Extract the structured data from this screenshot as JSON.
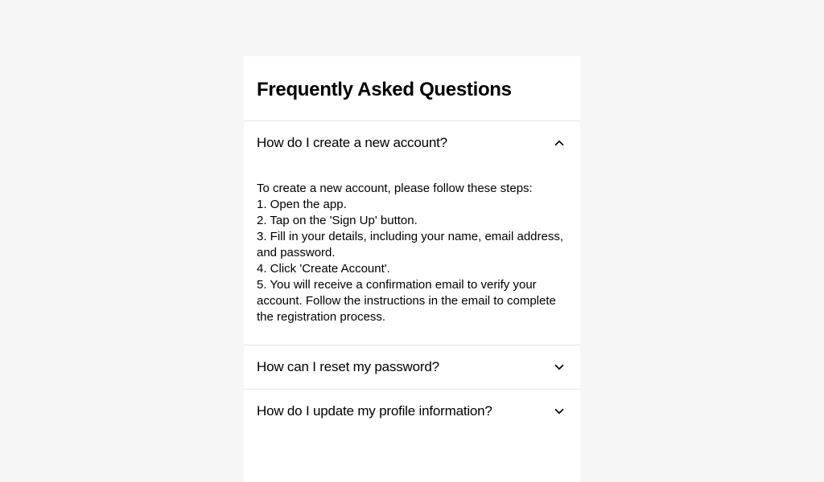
{
  "faq": {
    "title": "Frequently Asked Questions",
    "items": [
      {
        "question": "How do I create a new account?",
        "expanded": true,
        "answer": "To create a new account, please follow these steps:\n1. Open the app.\n2. Tap on the 'Sign Up' button.\n3. Fill in your details, including your name, email address, and password.\n4. Click 'Create Account'.\n5. You will receive a confirmation email to verify your account. Follow the instructions in the email to complete the registration process."
      },
      {
        "question": "How can I reset my password?",
        "expanded": false
      },
      {
        "question": "How do I update my profile information?",
        "expanded": false
      }
    ]
  }
}
